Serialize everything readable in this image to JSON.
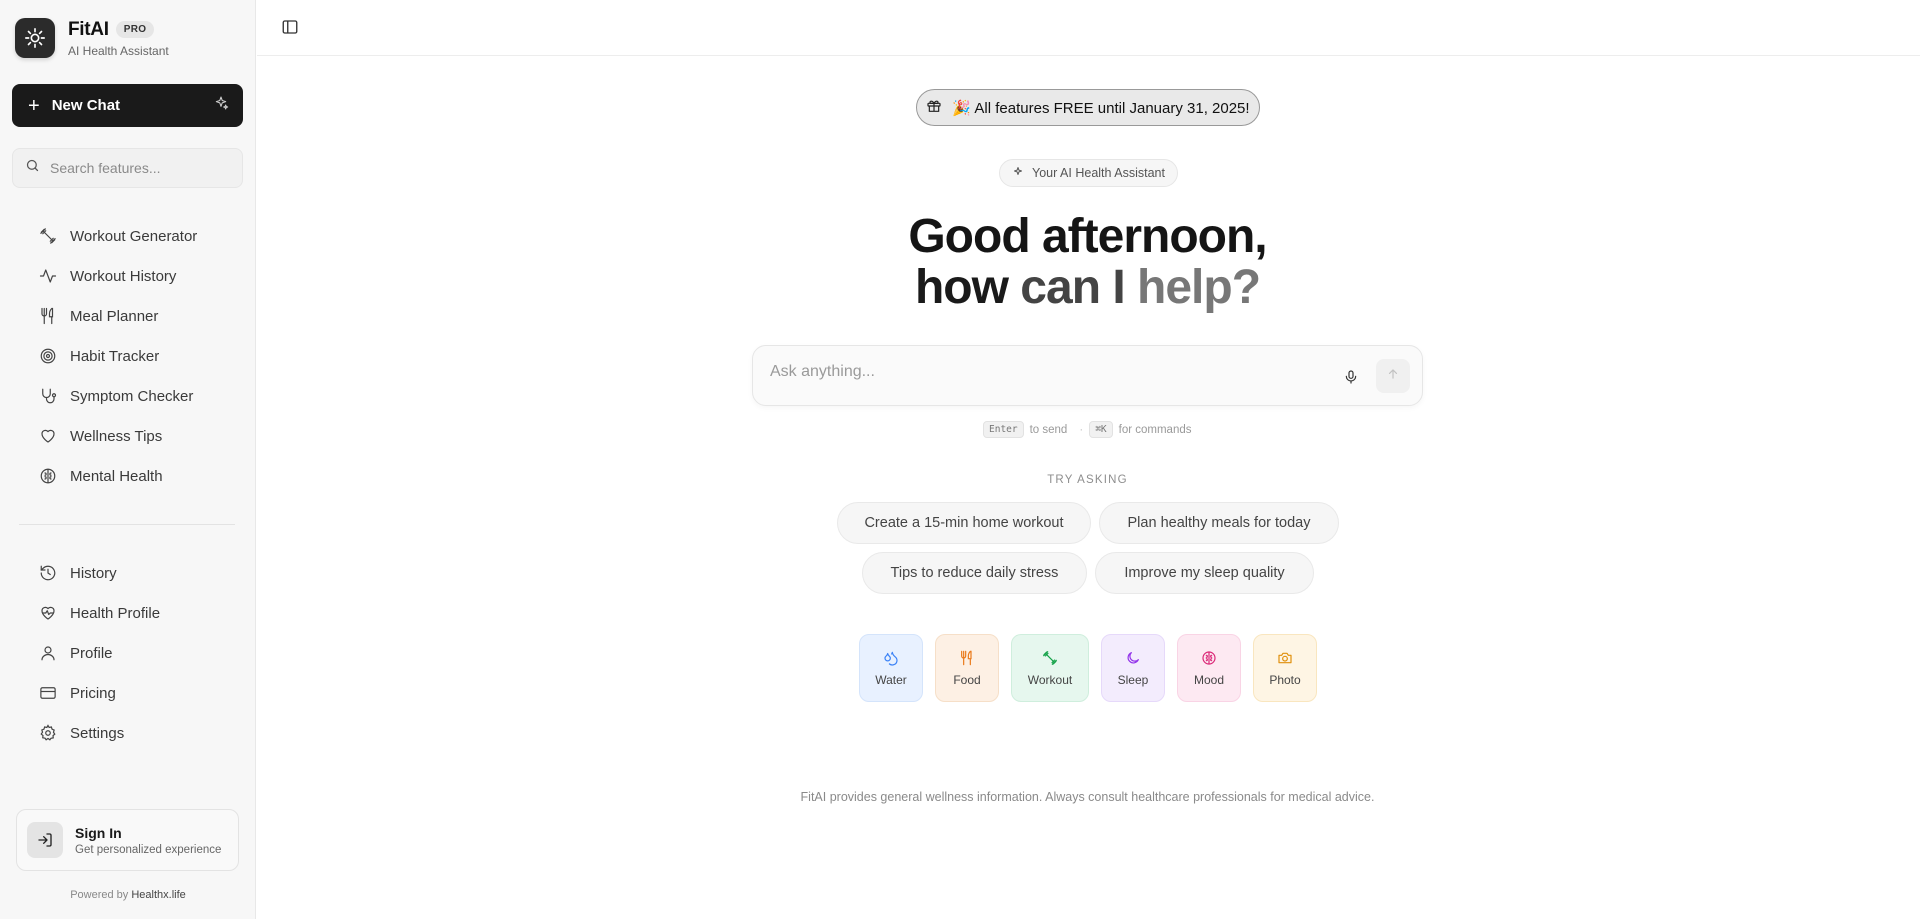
{
  "brand": {
    "name": "FitAI",
    "badge": "PRO",
    "subtitle": "AI Health Assistant"
  },
  "sidebar": {
    "new_chat_label": "New Chat",
    "search_placeholder": "Search features...",
    "features": [
      {
        "label": "Workout Generator",
        "icon": "dumbbell-icon"
      },
      {
        "label": "Workout History",
        "icon": "activity-icon"
      },
      {
        "label": "Meal Planner",
        "icon": "utensils-icon"
      },
      {
        "label": "Habit Tracker",
        "icon": "target-icon"
      },
      {
        "label": "Symptom Checker",
        "icon": "stethoscope-icon"
      },
      {
        "label": "Wellness Tips",
        "icon": "heart-icon"
      },
      {
        "label": "Mental Health",
        "icon": "brain-icon"
      }
    ],
    "account": [
      {
        "label": "History",
        "icon": "history-icon"
      },
      {
        "label": "Health Profile",
        "icon": "heart-pulse-icon"
      },
      {
        "label": "Profile",
        "icon": "user-icon"
      },
      {
        "label": "Pricing",
        "icon": "credit-card-icon"
      },
      {
        "label": "Settings",
        "icon": "gear-icon"
      }
    ],
    "signin": {
      "title": "Sign In",
      "subtitle": "Get personalized experience"
    },
    "powered_prefix": "Powered by",
    "powered_brand": "Healthx.life"
  },
  "main": {
    "banner": "🎉 All features FREE until January 31, 2025!",
    "assistant_pill": "Your AI Health Assistant",
    "greeting_line1": "Good afternoon,",
    "greeting_how": "how",
    "greeting_can": "can I",
    "greeting_help": "help?",
    "input_placeholder": "Ask anything...",
    "hint": {
      "enter_key": "Enter",
      "enter_text": "to send",
      "cmd_key": "⌘K",
      "cmd_text": "for commands",
      "separator": "·"
    },
    "try_label": "TRY ASKING",
    "suggestions": [
      "Create a 15-min home workout",
      "Plan healthy meals for today",
      "Tips to reduce daily stress",
      "Improve my sleep quality"
    ],
    "quick_actions": [
      {
        "label": "Water",
        "icon": "droplets-icon",
        "bg": "#e8f1ff",
        "border": "#d4e4fb",
        "color": "#3b82f6"
      },
      {
        "label": "Food",
        "icon": "utensils-icon",
        "bg": "#fdf0e4",
        "border": "#f6dfc8",
        "color": "#ea7a1a"
      },
      {
        "label": "Workout",
        "icon": "dumbbell-icon",
        "bg": "#e6f7ee",
        "border": "#cfeedd",
        "color": "#16a34a"
      },
      {
        "label": "Sleep",
        "icon": "moon-icon",
        "bg": "#f3ecfd",
        "border": "#e6d9fa",
        "color": "#9333ea"
      },
      {
        "label": "Mood",
        "icon": "brain-icon",
        "bg": "#fde9f2",
        "border": "#f9d4e5",
        "color": "#db2777"
      },
      {
        "label": "Photo",
        "icon": "camera-icon",
        "bg": "#fef5e4",
        "border": "#f9e6bf",
        "color": "#e0900c"
      }
    ],
    "disclaimer": "FitAI provides general wellness information. Always consult healthcare professionals for medical advice."
  }
}
